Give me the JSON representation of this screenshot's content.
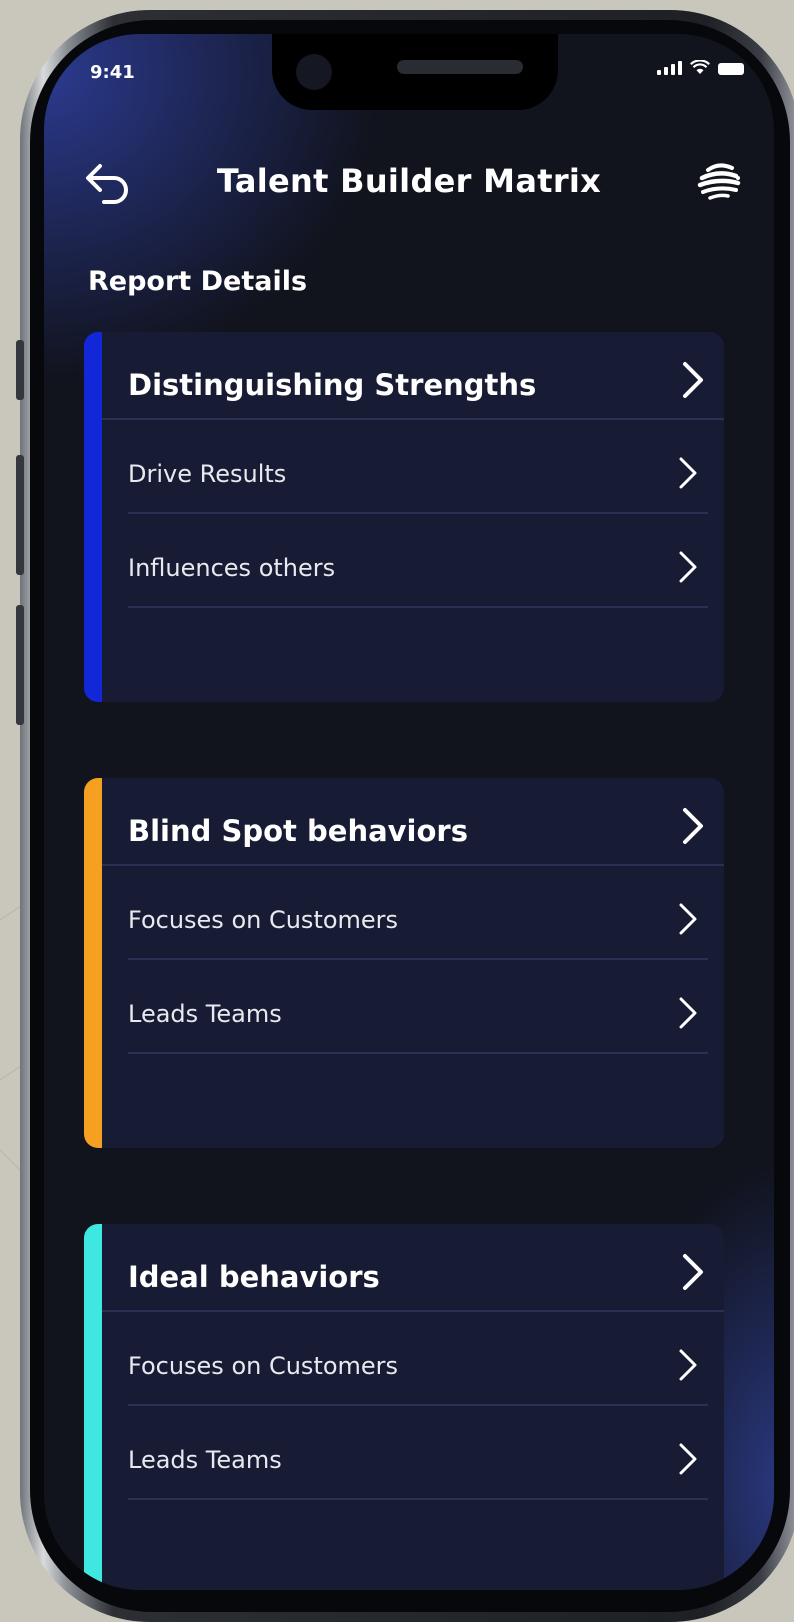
{
  "status_bar": {
    "time": "9:41"
  },
  "header": {
    "title": "Talent Builder Matrix",
    "back_icon": "back-arrow-icon",
    "menu_icon": "globe-icon"
  },
  "section": {
    "title": "Report Details"
  },
  "cards": [
    {
      "title": "Distinguishing Strengths",
      "accent": "#1228d8",
      "items": [
        "Drive Results",
        "Influences others"
      ]
    },
    {
      "title": "Blind Spot behaviors",
      "accent": "#f5a021",
      "items": [
        "Focuses on Customers",
        "Leads Teams"
      ]
    },
    {
      "title": "Ideal behaviors",
      "accent": "#3ee8e0",
      "items": [
        "Focuses on Customers",
        "Leads Teams"
      ]
    }
  ]
}
